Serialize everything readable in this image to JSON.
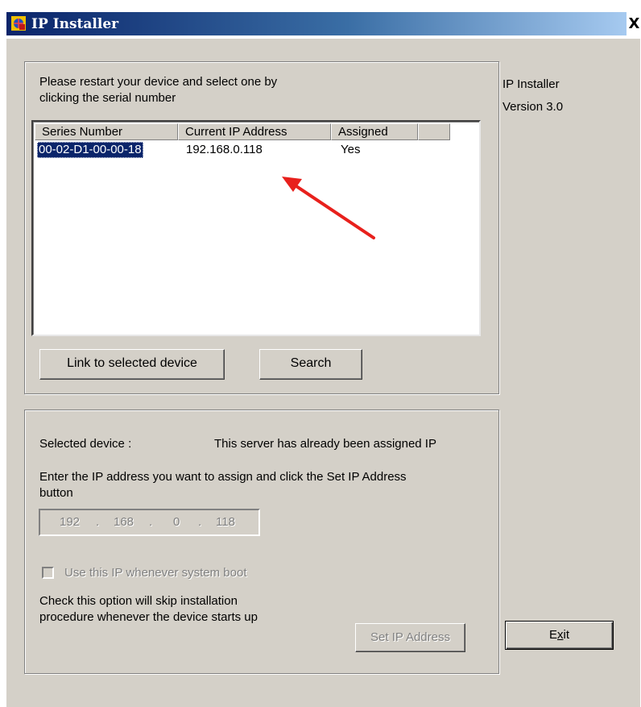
{
  "window": {
    "title": "IP Installer",
    "close_glyph": "X",
    "icon": "app-globe-icon"
  },
  "side_info": {
    "app_name": "IP Installer",
    "version": "Version 3.0"
  },
  "device_list_group": {
    "instruction_line1": "Please restart your device and select one by",
    "instruction_line2": "clicking the serial number",
    "columns": [
      "Series Number",
      "Current IP Address",
      "Assigned"
    ],
    "rows": [
      {
        "series": "00-02-D1-00-00-18",
        "ip": "192.168.0.118",
        "assigned": "Yes",
        "selected": true
      }
    ],
    "link_button": "Link to selected device",
    "search_button": "Search"
  },
  "assign_group": {
    "selected_device_label": "Selected device :",
    "selected_device_status": "This server has already been assigned IP",
    "prompt_line1": "Enter the IP address you want to assign and click the Set IP Address",
    "prompt_line2": "button",
    "ip_octets": [
      "192",
      "168",
      "0",
      "118"
    ],
    "ip_separator": ".",
    "checkbox_label": "Use this IP whenever system boot",
    "checkbox_checked": false,
    "note_line1": "Check this option will skip installation",
    "note_line2": "procedure whenever the device starts up",
    "set_ip_button": "Set IP Address"
  },
  "exit_button": {
    "label_pre": "E",
    "label_mnemonic": "x",
    "label_post": "it"
  },
  "annotation": {
    "arrow_color": "#e8201c"
  },
  "colors": {
    "face": "#d4d0c8",
    "title_start": "#0a246a",
    "title_end": "#a6caf0",
    "selection": "#0a246a"
  }
}
